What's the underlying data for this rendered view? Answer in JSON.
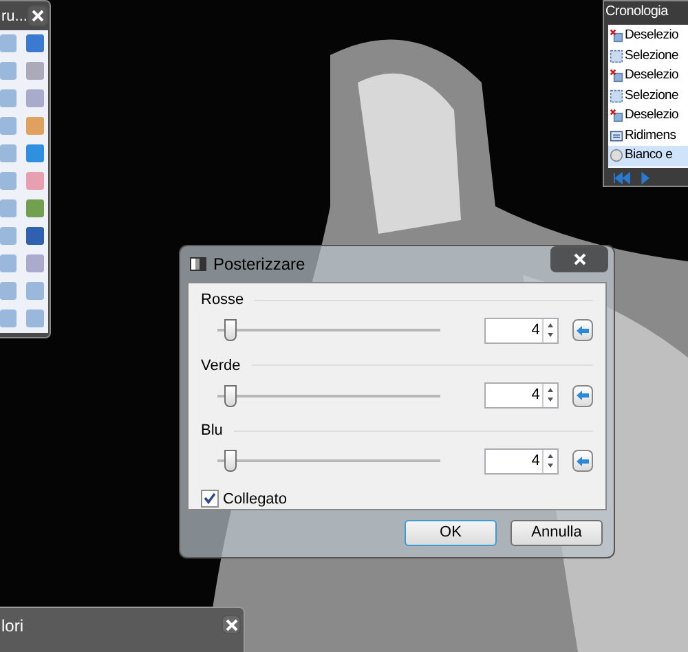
{
  "tools_window": {
    "title": "ru..."
  },
  "history_panel": {
    "title": "Cronologia",
    "items": [
      {
        "label": "Deselezio",
        "kind": "deselect",
        "selected": false
      },
      {
        "label": "Selezione",
        "kind": "select",
        "selected": false
      },
      {
        "label": "Deselezio",
        "kind": "deselect",
        "selected": false
      },
      {
        "label": "Selezione",
        "kind": "select",
        "selected": false
      },
      {
        "label": "Deselezio",
        "kind": "deselect",
        "selected": false
      },
      {
        "label": "Ridimens",
        "kind": "resize",
        "selected": false
      },
      {
        "label": "Bianco e",
        "kind": "bw",
        "selected": true
      }
    ]
  },
  "dialog": {
    "title": "Posterizzare",
    "channels": [
      {
        "label": "Rosse",
        "value": "4",
        "level": 0.03
      },
      {
        "label": "Verde",
        "value": "4",
        "level": 0.03
      },
      {
        "label": "Blu",
        "value": "4",
        "level": 0.03
      }
    ],
    "linked": {
      "label": "Collegato",
      "checked": true
    },
    "buttons": [
      "OK",
      "Annulla"
    ]
  },
  "colors_window": {
    "title": "lori"
  }
}
